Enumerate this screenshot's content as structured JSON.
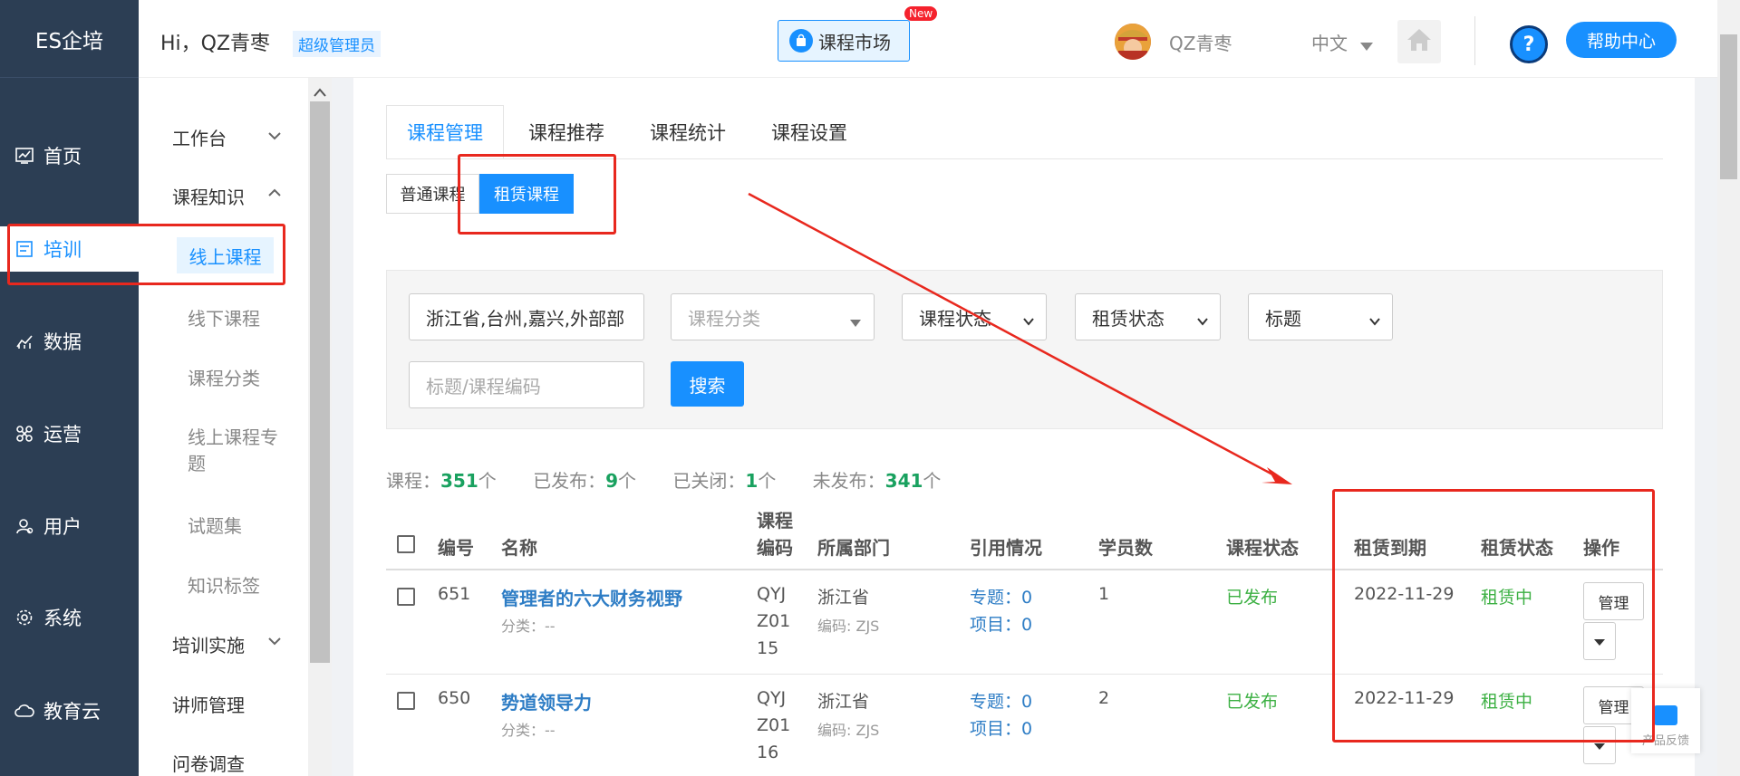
{
  "brand": "ES企培",
  "leftnav": {
    "items": [
      {
        "label": "首页",
        "icon": "chart-icon"
      },
      {
        "label": "培训",
        "icon": "training-icon"
      },
      {
        "label": "数据",
        "icon": "stats-icon"
      },
      {
        "label": "运营",
        "icon": "operations-icon"
      },
      {
        "label": "用户",
        "icon": "user-icon"
      },
      {
        "label": "系统",
        "icon": "settings-icon"
      },
      {
        "label": "教育云",
        "icon": "cloud-icon"
      }
    ],
    "active": "培训"
  },
  "header": {
    "greeting": "Hi，QZ青枣",
    "role": "超级管理员",
    "market_label": "课程市场",
    "new_badge": "New",
    "username": "QZ青枣",
    "language": "中文",
    "help_label": "帮助中心",
    "help_icon_text": "?"
  },
  "subnav": {
    "groups": [
      {
        "label": "工作台"
      },
      {
        "label": "课程知识"
      },
      {
        "label": "培训实施"
      },
      {
        "label": "讲师管理"
      },
      {
        "label": "问卷调查"
      }
    ],
    "items": [
      "线上课程",
      "线下课程",
      "课程分类",
      "线上课程专",
      "题",
      "试题集",
      "知识标签"
    ],
    "active": "线上课程"
  },
  "tabs": [
    "课程管理",
    "课程推荐",
    "课程统计",
    "课程设置"
  ],
  "subtabs": [
    "普通课程",
    "租赁课程"
  ],
  "filters": {
    "region": "浙江省,台州,嘉兴,外部部",
    "category_placeholder": "课程分类",
    "status": "课程状态",
    "lease_status": "租赁状态",
    "title_select": "标题",
    "keyword_placeholder": "标题/课程编码",
    "search_label": "搜索"
  },
  "stats": {
    "courses_label": "课程：",
    "courses": "351",
    "courses_unit": "个",
    "published_label": "已发布：",
    "published": "9",
    "published_unit": "个",
    "closed_label": "已关闭：",
    "closed": "1",
    "closed_unit": "个",
    "unpublished_label": "未发布：",
    "unpublished": "341",
    "unpublished_unit": "个"
  },
  "table": {
    "headers": {
      "id": "编号",
      "name": "名称",
      "code_1": "课程",
      "code_2": "编码",
      "dept": "所属部门",
      "refs": "引用情况",
      "students": "学员数",
      "status": "课程状态",
      "expire": "租赁到期",
      "lease": "租赁状态",
      "ops": "操作"
    },
    "rows": [
      {
        "id": "651",
        "name": "管理者的六大财务视野",
        "category": "分类：--",
        "code_lines": [
          "QYJ",
          "Z01",
          "15"
        ],
        "dept": "浙江省",
        "dept_code": "编码: ZJS",
        "topic": "专题：0",
        "project": "项目：0",
        "students": "1",
        "status": "已发布",
        "expire": "2022-11-29",
        "lease": "租赁中",
        "manage": "管理"
      },
      {
        "id": "650",
        "name": "势道领导力",
        "category": "分类：--",
        "code_lines": [
          "QYJ",
          "Z01",
          "16"
        ],
        "dept": "浙江省",
        "dept_code": "编码: ZJS",
        "topic": "专题：0",
        "project": "项目：0",
        "students": "2",
        "status": "已发布",
        "expire": "2022-11-29",
        "lease": "租赁中",
        "manage": "管理"
      }
    ]
  },
  "feedback_label": "产品反馈",
  "colors": {
    "sidebar": "#2c3e54",
    "accent": "#1890ff",
    "green": "#19a15f",
    "annotation": "#e8281e"
  }
}
